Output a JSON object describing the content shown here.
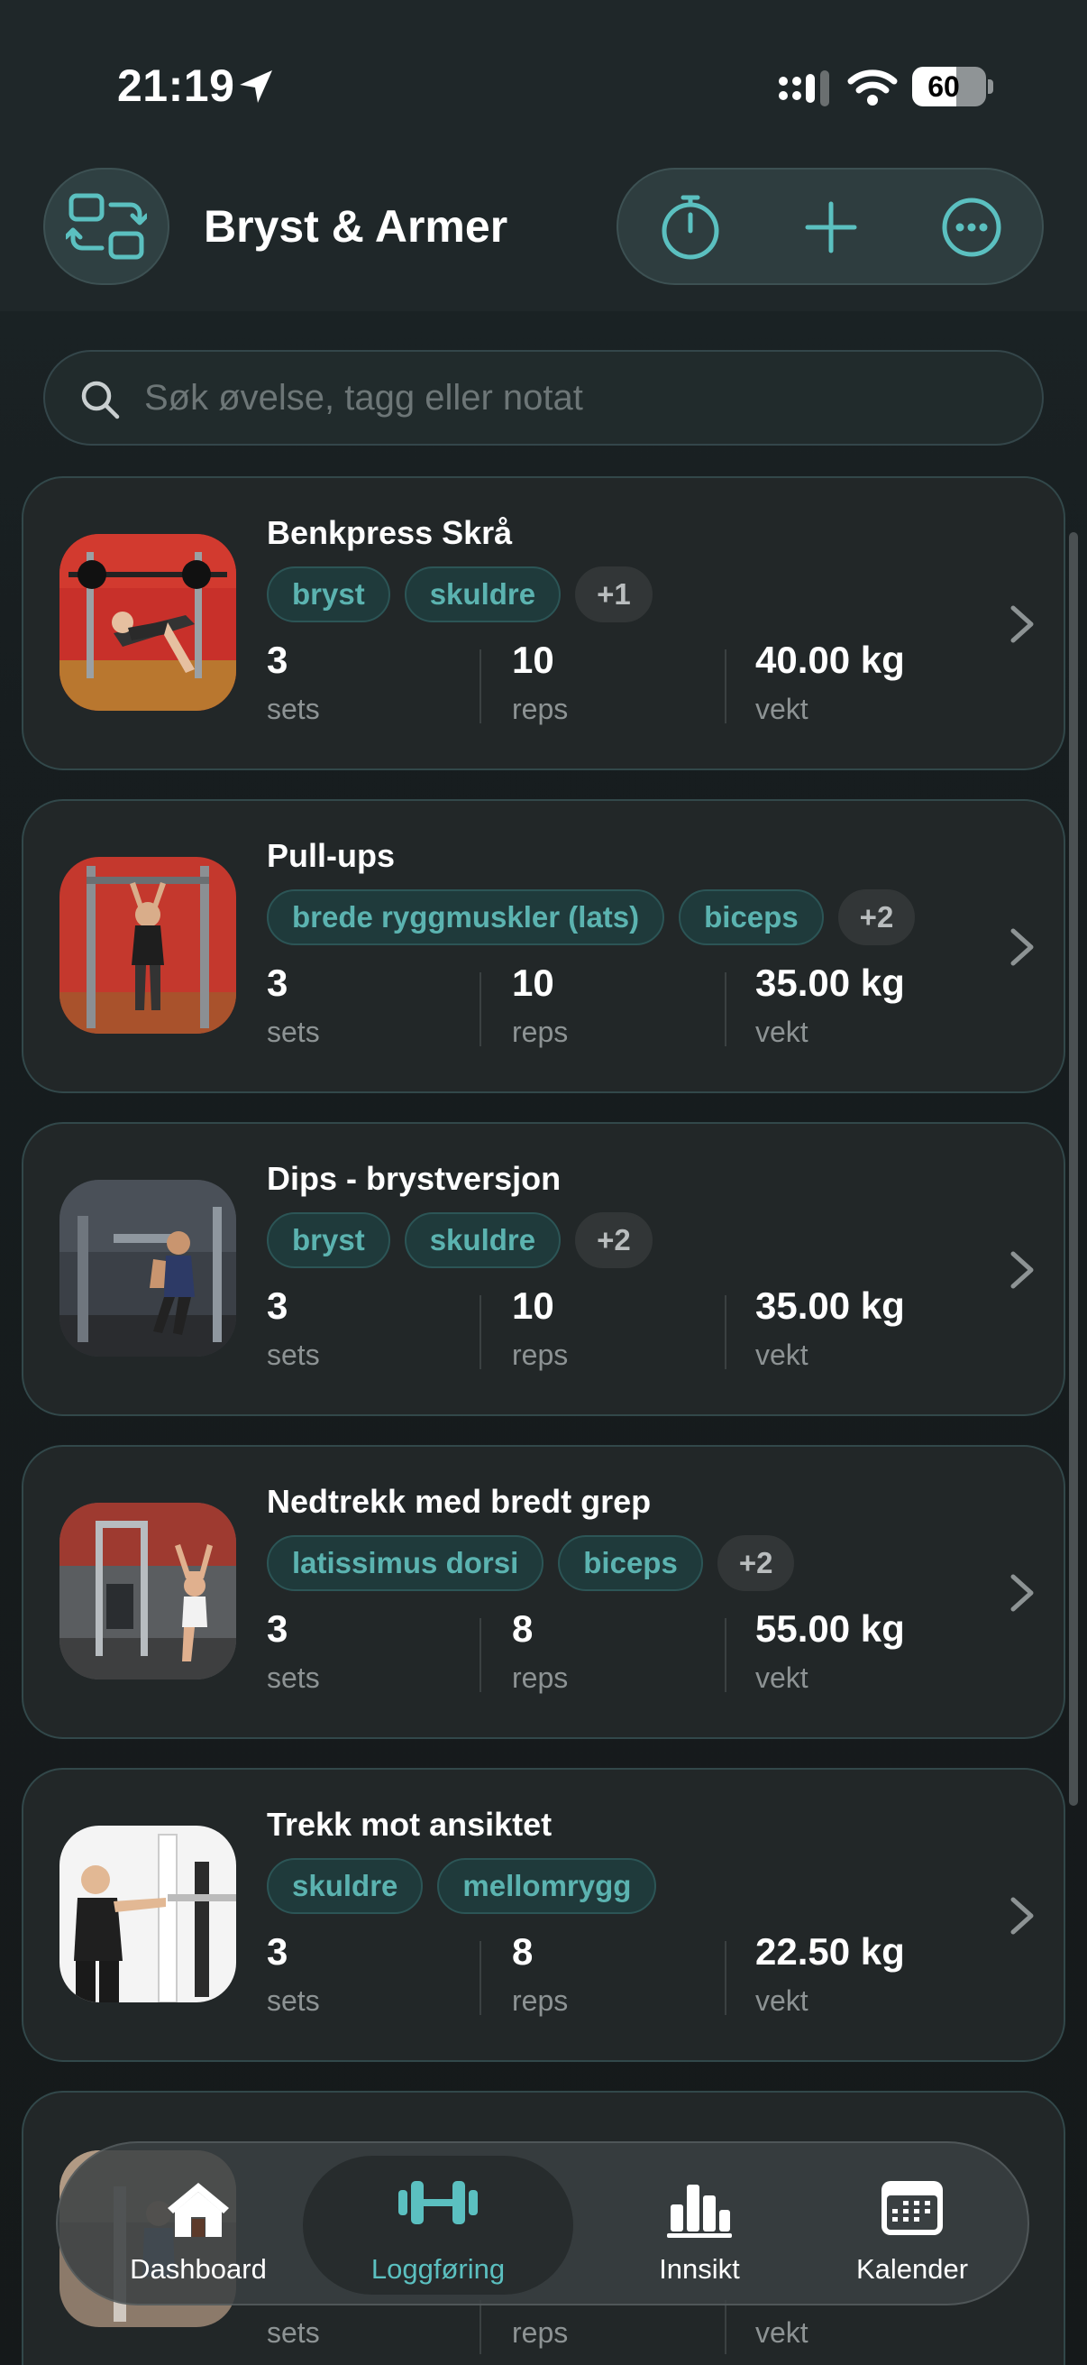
{
  "status_bar": {
    "time": "21:19",
    "battery": "60",
    "battery_level": 0.6
  },
  "header": {
    "title": "Bryst & Armer"
  },
  "search": {
    "placeholder": "Søk øvelse, tagg eller notat"
  },
  "stat_labels": {
    "sets": "sets",
    "reps": "reps",
    "weight": "vekt"
  },
  "exercises": [
    {
      "name": "Benkpress Skrå",
      "tags": [
        "bryst",
        "skuldre",
        "+1"
      ],
      "sets": "3",
      "reps": "10",
      "weight": "40.00 kg"
    },
    {
      "name": "Pull-ups",
      "tags": [
        "brede ryggmuskler (lats)",
        "biceps",
        "+2"
      ],
      "sets": "3",
      "reps": "10",
      "weight": "35.00 kg"
    },
    {
      "name": "Dips - brystversjon",
      "tags": [
        "bryst",
        "skuldre",
        "+2"
      ],
      "sets": "3",
      "reps": "10",
      "weight": "35.00 kg"
    },
    {
      "name": "Nedtrekk med bredt grep",
      "tags": [
        "latissimus dorsi",
        "biceps",
        "+2"
      ],
      "sets": "3",
      "reps": "8",
      "weight": "55.00 kg"
    },
    {
      "name": "Trekk mot ansiktet",
      "tags": [
        "skuldre",
        "mellomrygg"
      ],
      "sets": "3",
      "reps": "8",
      "weight": "22.50 kg"
    }
  ],
  "tabbar": {
    "tabs": [
      {
        "label": "Dashboard",
        "icon": "home-icon"
      },
      {
        "label": "Loggføring",
        "icon": "dumbbell-icon",
        "active": true
      },
      {
        "label": "Innsikt",
        "icon": "bar-chart-icon"
      },
      {
        "label": "Kalender",
        "icon": "calendar-icon"
      }
    ]
  },
  "colors": {
    "accent": "#5bc0c0",
    "tag_bg": "#1f3a3b",
    "card_bg": "#222728"
  }
}
